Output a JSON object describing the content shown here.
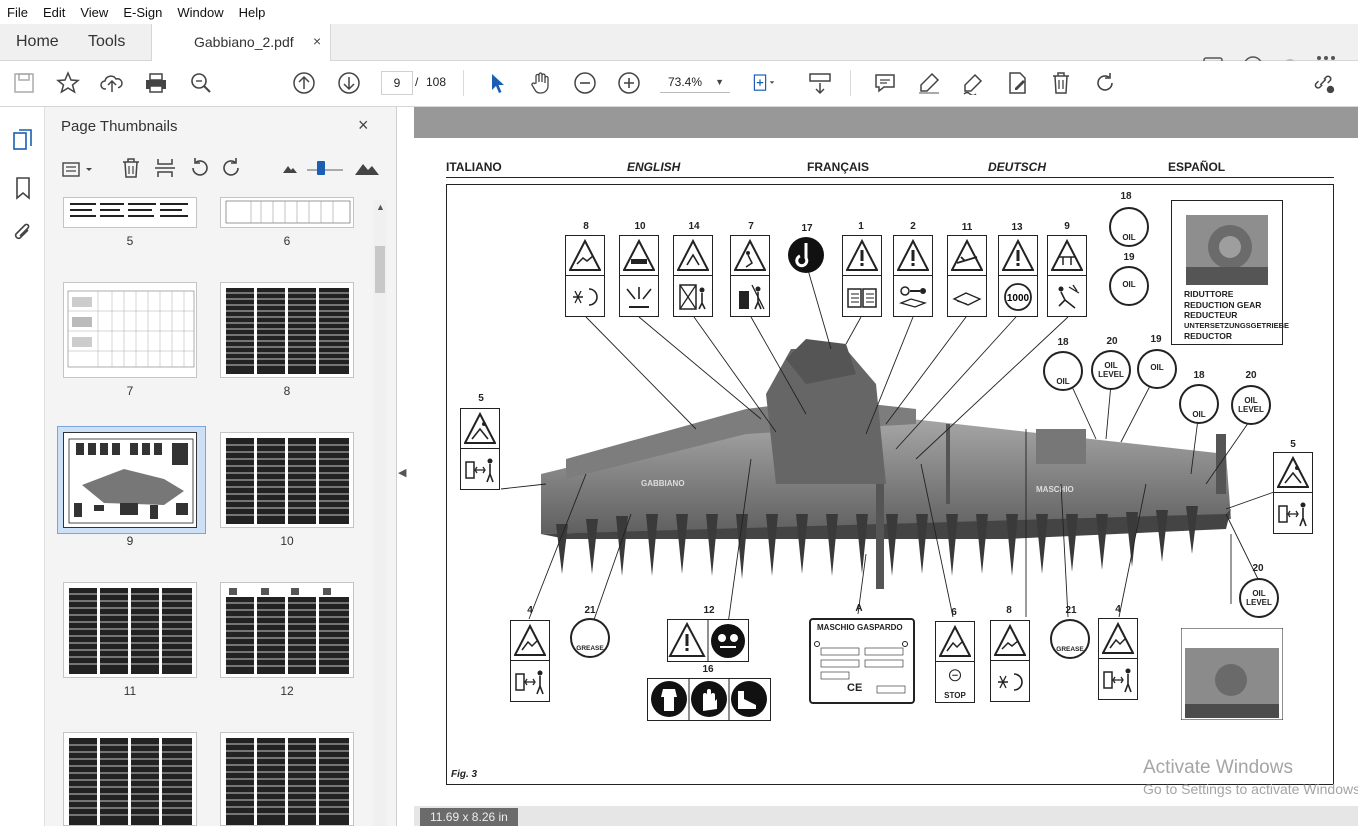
{
  "menu": [
    "File",
    "Edit",
    "View",
    "E-Sign",
    "Window",
    "Help"
  ],
  "tabs": {
    "home": "Home",
    "tools": "Tools",
    "document": "Gabbiano_2.pdf",
    "close": "×"
  },
  "toolbar": {
    "page_current": "9",
    "page_sep": "/",
    "page_total": "108",
    "zoom": "73.4%"
  },
  "panel": {
    "title": "Page Thumbnails",
    "close": "×",
    "labels": [
      "5",
      "6",
      "7",
      "8",
      "9",
      "10",
      "11",
      "12"
    ]
  },
  "status": {
    "page_size": "11.69 x 8.26 in"
  },
  "document": {
    "languages": [
      "ITALIANO",
      "ENGLISH",
      "FRANÇAIS",
      "DEUTSCH",
      "ESPAÑOL"
    ],
    "figure_label": "Fig. 3",
    "callouts_top": [
      "8",
      "10",
      "14",
      "7",
      "17",
      "1",
      "2",
      "11",
      "13",
      "9"
    ],
    "callouts_right": [
      "18",
      "19",
      "18",
      "20",
      "19",
      "18",
      "20",
      "5",
      "20"
    ],
    "callouts_left": [
      "5"
    ],
    "callouts_bottom": [
      "4",
      "21",
      "12",
      "16",
      "A",
      "6",
      "8",
      "21",
      "4"
    ],
    "reduction_text": [
      "RIDUTTORE",
      "REDUCTION GEAR",
      "REDUCTEUR",
      "UNTERSETZUNGSGETRIEBE",
      "REDUCTOR"
    ],
    "oil": "OIL",
    "oil_level": [
      "OIL",
      "LEVEL"
    ],
    "grease": "GREASE",
    "stop": "STOP",
    "pto": "1000",
    "plate_brand": "MASCHIO GASPARDO",
    "ce": "CE",
    "brand_on_machine": "MASCHIO",
    "brand_model": "GABBIANO"
  },
  "watermark": {
    "line1": "Activate Windows",
    "line2": "Go to Settings to activate Windows."
  }
}
